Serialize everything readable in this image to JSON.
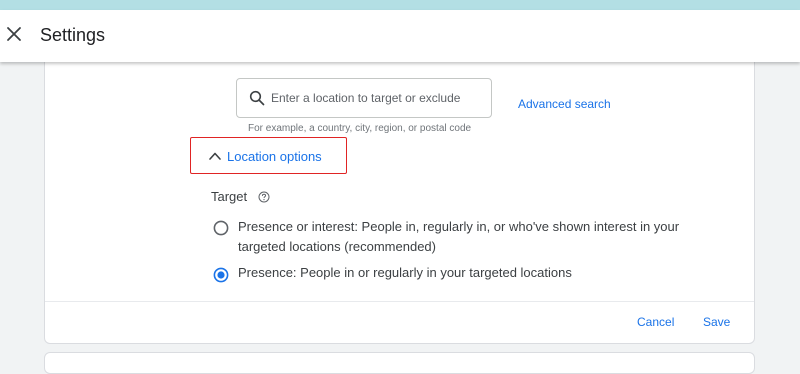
{
  "header": {
    "title": "Settings"
  },
  "location_search": {
    "placeholder": "Enter a location to target or exclude",
    "value": "",
    "helper": "For example, a country, city, region, or postal code",
    "advanced_link": "Advanced search"
  },
  "location_options": {
    "label": "Location options",
    "expanded": true,
    "highlight_color": "#e02424"
  },
  "target": {
    "label": "Target",
    "options": [
      {
        "label": "Presence or interest: People in, regularly in, or who've shown interest in your targeted locations (recommended)",
        "selected": false
      },
      {
        "label": "Presence: People in or regularly in your targeted locations",
        "selected": true
      }
    ]
  },
  "actions": {
    "cancel_label": "Cancel",
    "save_label": "Save"
  },
  "colors": {
    "accent": "#1a73e8",
    "top_strip": "#b3dfe4",
    "text": "#3c4043"
  }
}
